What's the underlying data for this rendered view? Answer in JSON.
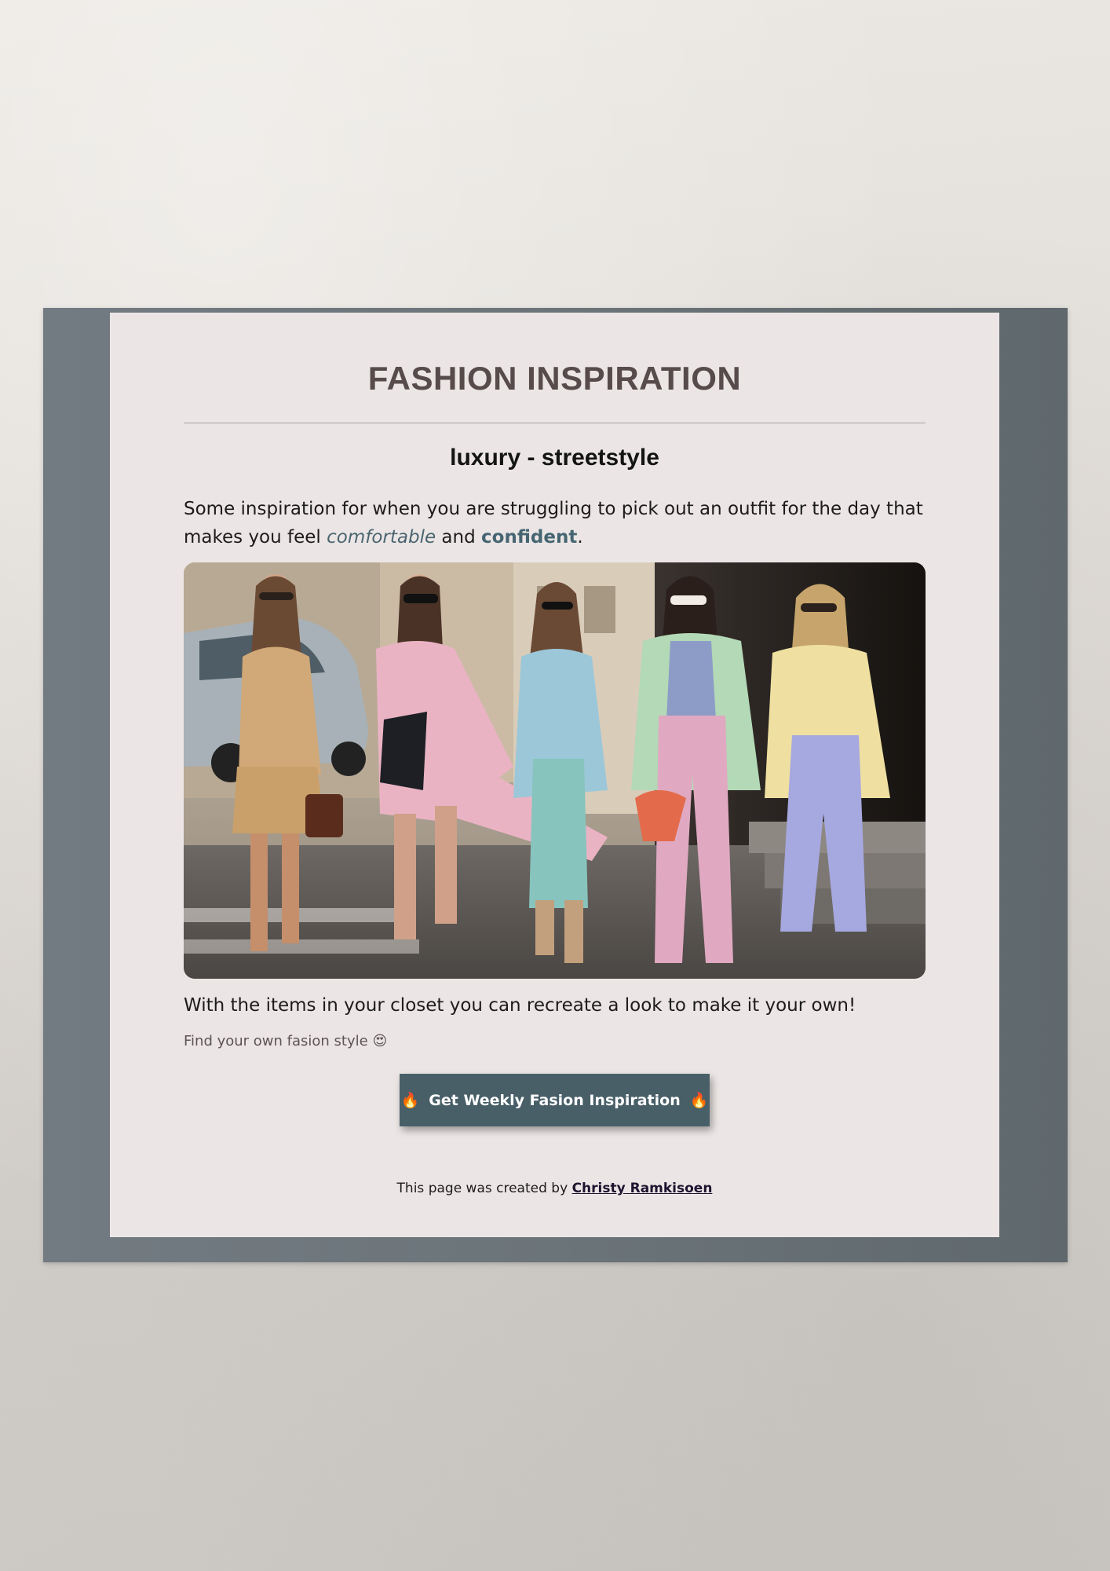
{
  "page": {
    "title": "FASHION INSPIRATION",
    "subtitle": "luxury - streetstyle",
    "intro": {
      "before": "Some inspiration for when you are struggling to pick out an outfit for the day that makes you feel ",
      "emphasis": "comfortable",
      "middle": " and ",
      "strong": "confident",
      "after": "."
    },
    "hero_image": {
      "icon": "streetstyle-photo",
      "alt_visible": ""
    },
    "closet_text": "With the items in your closet you can recreate a look to make it your own!",
    "style_text": "Find your own fasion style",
    "style_emoji": "😍",
    "cta": {
      "label": "Get Weekly Fasion Inspiration",
      "icon_left": "🔥",
      "icon_right": "🔥"
    },
    "footer": {
      "prefix": "This page was created by ",
      "author": "Christy Ramkisoen"
    }
  },
  "colors": {
    "frame": "#6b7479",
    "card": "#ebe6e5",
    "title": "#574b4c",
    "accent": "#485f68",
    "emphasis": "#4b6570"
  }
}
